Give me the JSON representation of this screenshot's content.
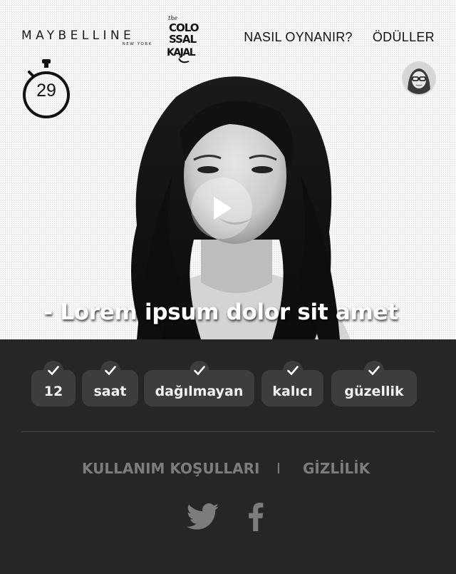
{
  "header": {
    "brand": "MAYBELLINE",
    "brand_subline": "NEW YORK",
    "campaign_logo_text": [
      "the",
      "COLO",
      "SSAL",
      "KAJAL"
    ],
    "nav": [
      {
        "label": "NASIL OYNANIR?"
      },
      {
        "label": "ÖDÜLLER"
      }
    ]
  },
  "timer": {
    "value": "29"
  },
  "hero": {
    "headline": "- Lorem ipsum dolor sit amet"
  },
  "tags": [
    {
      "label": "12"
    },
    {
      "label": "saat"
    },
    {
      "label": "dağılmayan"
    },
    {
      "label": "kalıcı"
    },
    {
      "label": "güzellik"
    }
  ],
  "footer": {
    "links": [
      {
        "label": "KULLANIM KOŞULLARI"
      },
      {
        "label": "GİZLİLİK"
      }
    ],
    "separator": "I"
  },
  "colors": {
    "footer_bg": "#262626",
    "tag_bg": "#3d3d3d",
    "link_color": "#7c7c7c",
    "social_icon": "#7c7c7c"
  },
  "icons": [
    "stopwatch-icon",
    "play-icon",
    "check-icon",
    "twitter-icon",
    "facebook-icon"
  ]
}
